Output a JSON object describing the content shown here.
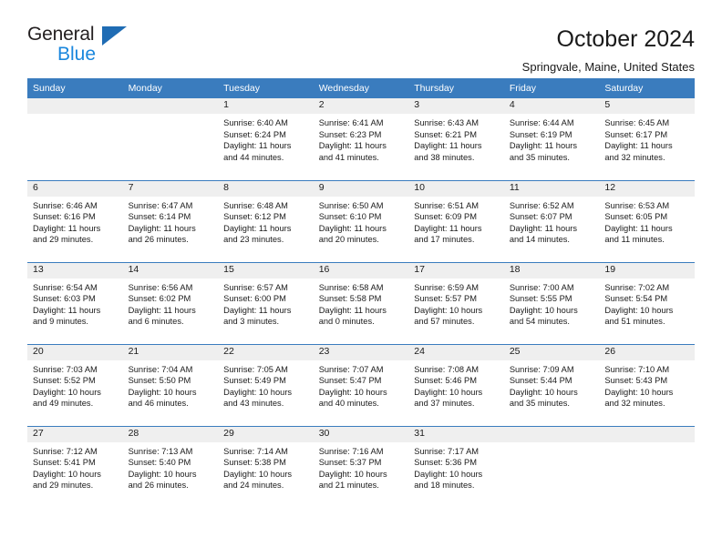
{
  "brand": {
    "name_top": "General",
    "name_bottom": "Blue",
    "triangle_color": "#1f6cb4",
    "blue_text_color": "#1a87dd"
  },
  "header": {
    "title": "October 2024",
    "subtitle": "Springvale, Maine, United States",
    "header_bg": "#3a7cbe",
    "date_band_bg": "#efefef"
  },
  "weekday_headers": [
    "Sunday",
    "Monday",
    "Tuesday",
    "Wednesday",
    "Thursday",
    "Friday",
    "Saturday"
  ],
  "weeks": [
    [
      {
        "date": "",
        "empty": true
      },
      {
        "date": "",
        "empty": true
      },
      {
        "date": "1",
        "sunrise": "Sunrise: 6:40 AM",
        "sunset": "Sunset: 6:24 PM",
        "daylight_line1": "Daylight: 11 hours",
        "daylight_line2": "and 44 minutes."
      },
      {
        "date": "2",
        "sunrise": "Sunrise: 6:41 AM",
        "sunset": "Sunset: 6:23 PM",
        "daylight_line1": "Daylight: 11 hours",
        "daylight_line2": "and 41 minutes."
      },
      {
        "date": "3",
        "sunrise": "Sunrise: 6:43 AM",
        "sunset": "Sunset: 6:21 PM",
        "daylight_line1": "Daylight: 11 hours",
        "daylight_line2": "and 38 minutes."
      },
      {
        "date": "4",
        "sunrise": "Sunrise: 6:44 AM",
        "sunset": "Sunset: 6:19 PM",
        "daylight_line1": "Daylight: 11 hours",
        "daylight_line2": "and 35 minutes."
      },
      {
        "date": "5",
        "sunrise": "Sunrise: 6:45 AM",
        "sunset": "Sunset: 6:17 PM",
        "daylight_line1": "Daylight: 11 hours",
        "daylight_line2": "and 32 minutes."
      }
    ],
    [
      {
        "date": "6",
        "sunrise": "Sunrise: 6:46 AM",
        "sunset": "Sunset: 6:16 PM",
        "daylight_line1": "Daylight: 11 hours",
        "daylight_line2": "and 29 minutes."
      },
      {
        "date": "7",
        "sunrise": "Sunrise: 6:47 AM",
        "sunset": "Sunset: 6:14 PM",
        "daylight_line1": "Daylight: 11 hours",
        "daylight_line2": "and 26 minutes."
      },
      {
        "date": "8",
        "sunrise": "Sunrise: 6:48 AM",
        "sunset": "Sunset: 6:12 PM",
        "daylight_line1": "Daylight: 11 hours",
        "daylight_line2": "and 23 minutes."
      },
      {
        "date": "9",
        "sunrise": "Sunrise: 6:50 AM",
        "sunset": "Sunset: 6:10 PM",
        "daylight_line1": "Daylight: 11 hours",
        "daylight_line2": "and 20 minutes."
      },
      {
        "date": "10",
        "sunrise": "Sunrise: 6:51 AM",
        "sunset": "Sunset: 6:09 PM",
        "daylight_line1": "Daylight: 11 hours",
        "daylight_line2": "and 17 minutes."
      },
      {
        "date": "11",
        "sunrise": "Sunrise: 6:52 AM",
        "sunset": "Sunset: 6:07 PM",
        "daylight_line1": "Daylight: 11 hours",
        "daylight_line2": "and 14 minutes."
      },
      {
        "date": "12",
        "sunrise": "Sunrise: 6:53 AM",
        "sunset": "Sunset: 6:05 PM",
        "daylight_line1": "Daylight: 11 hours",
        "daylight_line2": "and 11 minutes."
      }
    ],
    [
      {
        "date": "13",
        "sunrise": "Sunrise: 6:54 AM",
        "sunset": "Sunset: 6:03 PM",
        "daylight_line1": "Daylight: 11 hours",
        "daylight_line2": "and 9 minutes."
      },
      {
        "date": "14",
        "sunrise": "Sunrise: 6:56 AM",
        "sunset": "Sunset: 6:02 PM",
        "daylight_line1": "Daylight: 11 hours",
        "daylight_line2": "and 6 minutes."
      },
      {
        "date": "15",
        "sunrise": "Sunrise: 6:57 AM",
        "sunset": "Sunset: 6:00 PM",
        "daylight_line1": "Daylight: 11 hours",
        "daylight_line2": "and 3 minutes."
      },
      {
        "date": "16",
        "sunrise": "Sunrise: 6:58 AM",
        "sunset": "Sunset: 5:58 PM",
        "daylight_line1": "Daylight: 11 hours",
        "daylight_line2": "and 0 minutes."
      },
      {
        "date": "17",
        "sunrise": "Sunrise: 6:59 AM",
        "sunset": "Sunset: 5:57 PM",
        "daylight_line1": "Daylight: 10 hours",
        "daylight_line2": "and 57 minutes."
      },
      {
        "date": "18",
        "sunrise": "Sunrise: 7:00 AM",
        "sunset": "Sunset: 5:55 PM",
        "daylight_line1": "Daylight: 10 hours",
        "daylight_line2": "and 54 minutes."
      },
      {
        "date": "19",
        "sunrise": "Sunrise: 7:02 AM",
        "sunset": "Sunset: 5:54 PM",
        "daylight_line1": "Daylight: 10 hours",
        "daylight_line2": "and 51 minutes."
      }
    ],
    [
      {
        "date": "20",
        "sunrise": "Sunrise: 7:03 AM",
        "sunset": "Sunset: 5:52 PM",
        "daylight_line1": "Daylight: 10 hours",
        "daylight_line2": "and 49 minutes."
      },
      {
        "date": "21",
        "sunrise": "Sunrise: 7:04 AM",
        "sunset": "Sunset: 5:50 PM",
        "daylight_line1": "Daylight: 10 hours",
        "daylight_line2": "and 46 minutes."
      },
      {
        "date": "22",
        "sunrise": "Sunrise: 7:05 AM",
        "sunset": "Sunset: 5:49 PM",
        "daylight_line1": "Daylight: 10 hours",
        "daylight_line2": "and 43 minutes."
      },
      {
        "date": "23",
        "sunrise": "Sunrise: 7:07 AM",
        "sunset": "Sunset: 5:47 PM",
        "daylight_line1": "Daylight: 10 hours",
        "daylight_line2": "and 40 minutes."
      },
      {
        "date": "24",
        "sunrise": "Sunrise: 7:08 AM",
        "sunset": "Sunset: 5:46 PM",
        "daylight_line1": "Daylight: 10 hours",
        "daylight_line2": "and 37 minutes."
      },
      {
        "date": "25",
        "sunrise": "Sunrise: 7:09 AM",
        "sunset": "Sunset: 5:44 PM",
        "daylight_line1": "Daylight: 10 hours",
        "daylight_line2": "and 35 minutes."
      },
      {
        "date": "26",
        "sunrise": "Sunrise: 7:10 AM",
        "sunset": "Sunset: 5:43 PM",
        "daylight_line1": "Daylight: 10 hours",
        "daylight_line2": "and 32 minutes."
      }
    ],
    [
      {
        "date": "27",
        "sunrise": "Sunrise: 7:12 AM",
        "sunset": "Sunset: 5:41 PM",
        "daylight_line1": "Daylight: 10 hours",
        "daylight_line2": "and 29 minutes."
      },
      {
        "date": "28",
        "sunrise": "Sunrise: 7:13 AM",
        "sunset": "Sunset: 5:40 PM",
        "daylight_line1": "Daylight: 10 hours",
        "daylight_line2": "and 26 minutes."
      },
      {
        "date": "29",
        "sunrise": "Sunrise: 7:14 AM",
        "sunset": "Sunset: 5:38 PM",
        "daylight_line1": "Daylight: 10 hours",
        "daylight_line2": "and 24 minutes."
      },
      {
        "date": "30",
        "sunrise": "Sunrise: 7:16 AM",
        "sunset": "Sunset: 5:37 PM",
        "daylight_line1": "Daylight: 10 hours",
        "daylight_line2": "and 21 minutes."
      },
      {
        "date": "31",
        "sunrise": "Sunrise: 7:17 AM",
        "sunset": "Sunset: 5:36 PM",
        "daylight_line1": "Daylight: 10 hours",
        "daylight_line2": "and 18 minutes."
      },
      {
        "date": "",
        "empty": true
      },
      {
        "date": "",
        "empty": true
      }
    ]
  ]
}
